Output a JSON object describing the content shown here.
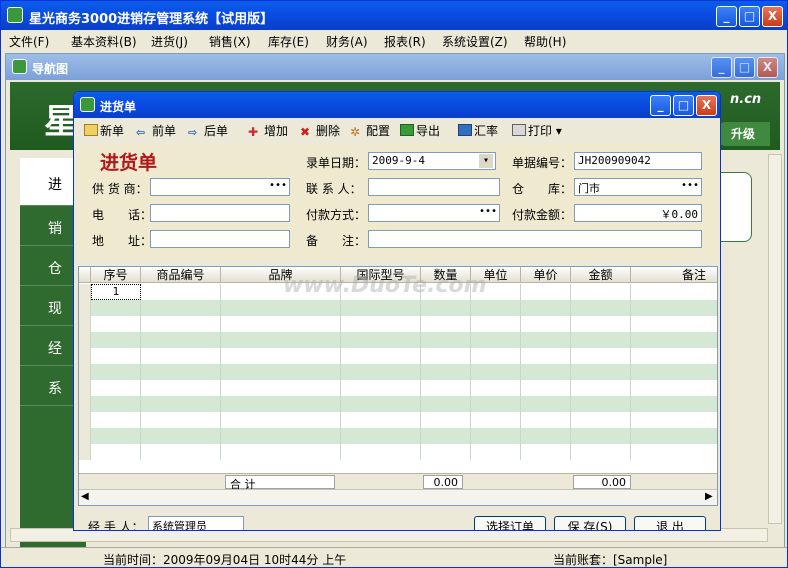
{
  "app": {
    "title": "星光商务3000进销存管理系统【试用版】"
  },
  "window_controls": {
    "minimize": "_",
    "maximize": "□",
    "close": "X"
  },
  "menu": [
    "文件(F)",
    "基本资料(B)",
    "进货(J)",
    "销售(X)",
    "库存(E)",
    "财务(A)",
    "报表(R)",
    "系统设置(Z)",
    "帮助(H)"
  ],
  "nav": {
    "title": "导航图",
    "banner_char": "星",
    "banner_url_tail": "n.cn",
    "banner_button": "升级",
    "tabs": [
      "进",
      "销",
      "仓",
      "现",
      "经",
      "系"
    ]
  },
  "dialog": {
    "title": "进货单",
    "toolbar": [
      "新单",
      "前单",
      "后单",
      "增加",
      "删除",
      "配置",
      "导出",
      "汇率",
      "打印"
    ],
    "heading": "进货单",
    "labels": {
      "date": "录单日期：",
      "bill_no": "单据编号：",
      "supplier": "供 货 商：",
      "contact": "联 系 人：",
      "warehouse": "仓　　库：",
      "phone": "电　　话：",
      "pay_method": "付款方式：",
      "pay_amount": "付款金额：",
      "address": "地　　址：",
      "remark": "备　　注："
    },
    "values": {
      "date": "2009-9-4",
      "bill_no": "JH200909042",
      "supplier": "",
      "contact": "",
      "warehouse": "门市",
      "phone": "",
      "pay_method": "",
      "pay_amount": "￥0.00",
      "address": "",
      "remark": ""
    },
    "grid": {
      "columns": [
        "序号",
        "商品编号",
        "品牌",
        "国际型号",
        "数量",
        "单位",
        "单价",
        "金额",
        "备注"
      ],
      "first_row_index": "1",
      "total_label": "合 计",
      "total_qty": "0.00",
      "total_amount": "0.00"
    },
    "footer": {
      "handler_label": "经 手 人：",
      "handler_value": "系统管理员",
      "select_order": "选择订单",
      "save": "保 存(S)",
      "exit": "退 出"
    }
  },
  "status": {
    "time": "当前时间：2009年09月04日 10时44分 上午",
    "account": "当前账套：[Sample]"
  },
  "watermark": "www.DuoTe.com"
}
